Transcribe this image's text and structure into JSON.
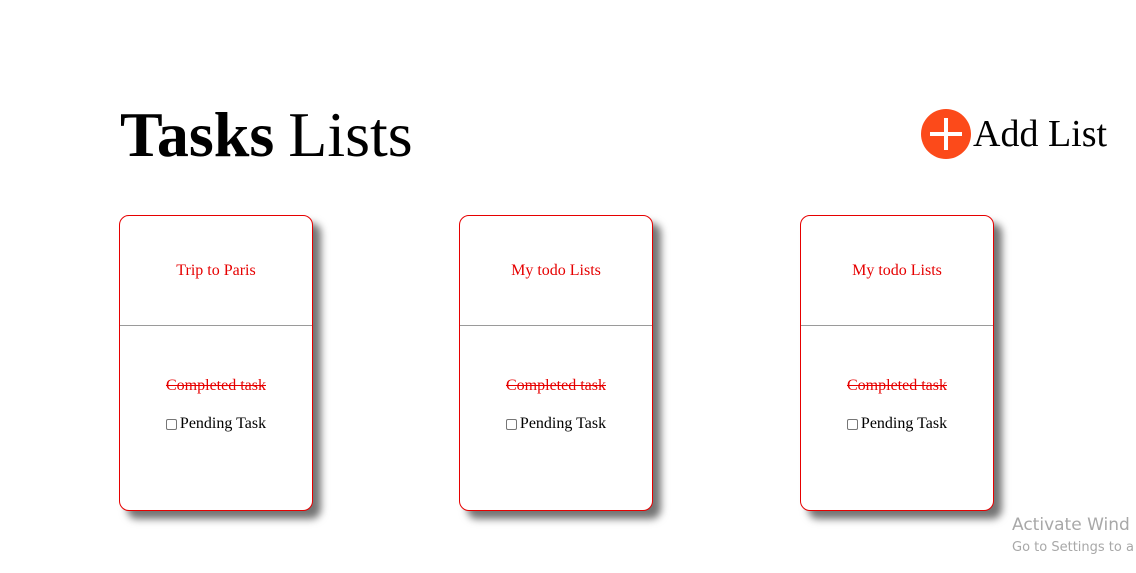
{
  "header": {
    "title_bold": "Tasks",
    "title_normal": "Lists",
    "add_list_label": "Add List",
    "add_icon": "plus-circle-icon",
    "accent_color": "#fc4a1a"
  },
  "cards": [
    {
      "title": "Trip to Paris",
      "completed_task": "Completed task",
      "pending_task": "Pending Task",
      "pending_checked": false
    },
    {
      "title": "My todo Lists",
      "completed_task": "Completed task",
      "pending_task": "Pending Task",
      "pending_checked": false
    },
    {
      "title": "My todo Lists",
      "completed_task": "Completed task",
      "pending_task": "Pending Task",
      "pending_checked": false
    }
  ],
  "card_border_color": "#e60000",
  "watermark": {
    "line1": "Activate Wind",
    "line2": "Go to Settings to a"
  }
}
